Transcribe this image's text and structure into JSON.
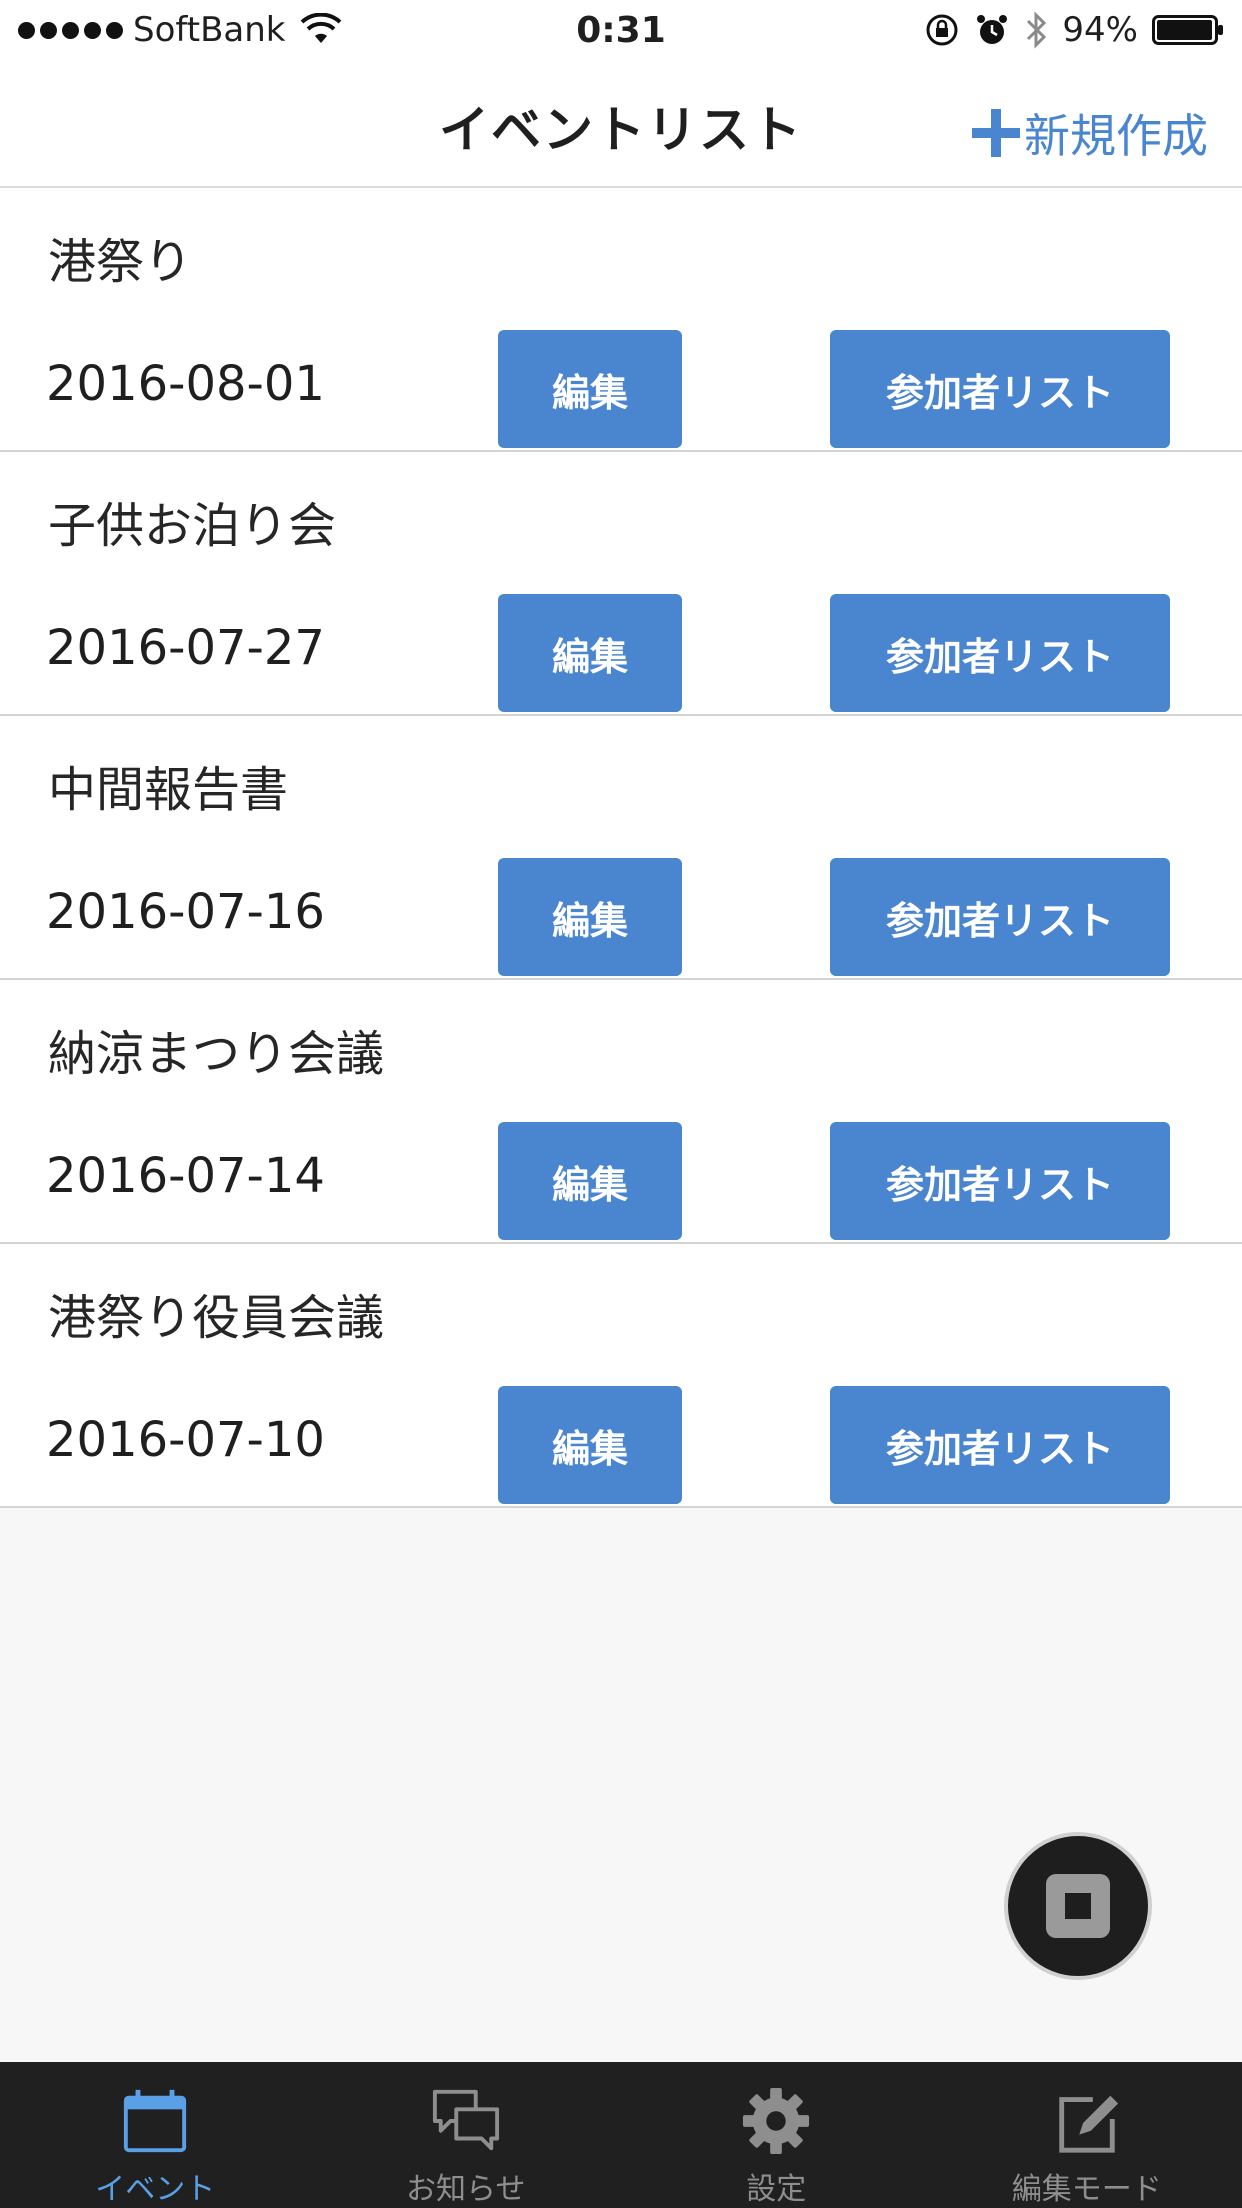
{
  "status_bar": {
    "carrier": "SoftBank",
    "time": "0:31",
    "battery": "94%"
  },
  "nav": {
    "title": "イベントリスト",
    "new_button_label": "新規作成"
  },
  "events": [
    {
      "title": "港祭り",
      "date": "2016-08-01",
      "edit_label": "編集",
      "participants_label": "参加者リスト"
    },
    {
      "title": "子供お泊り会",
      "date": "2016-07-27",
      "edit_label": "編集",
      "participants_label": "参加者リスト"
    },
    {
      "title": "中間報告書",
      "date": "2016-07-16",
      "edit_label": "編集",
      "participants_label": "参加者リスト"
    },
    {
      "title": "納涼まつり会議",
      "date": "2016-07-14",
      "edit_label": "編集",
      "participants_label": "参加者リスト"
    },
    {
      "title": "港祭り役員会議",
      "date": "2016-07-10",
      "edit_label": "編集",
      "participants_label": "参加者リスト"
    }
  ],
  "tabs": [
    {
      "label": "イベント",
      "icon": "calendar-icon",
      "active": true
    },
    {
      "label": "お知らせ",
      "icon": "chat-bubbles-icon",
      "active": false
    },
    {
      "label": "設定",
      "icon": "gear-icon",
      "active": false
    },
    {
      "label": "編集モード",
      "icon": "edit-icon",
      "active": false
    }
  ],
  "colors": {
    "accent": "#4a85cf",
    "tab_active": "#5aa0e6",
    "tab_inactive": "#8e8e8e",
    "tab_bar_bg": "#202020"
  }
}
